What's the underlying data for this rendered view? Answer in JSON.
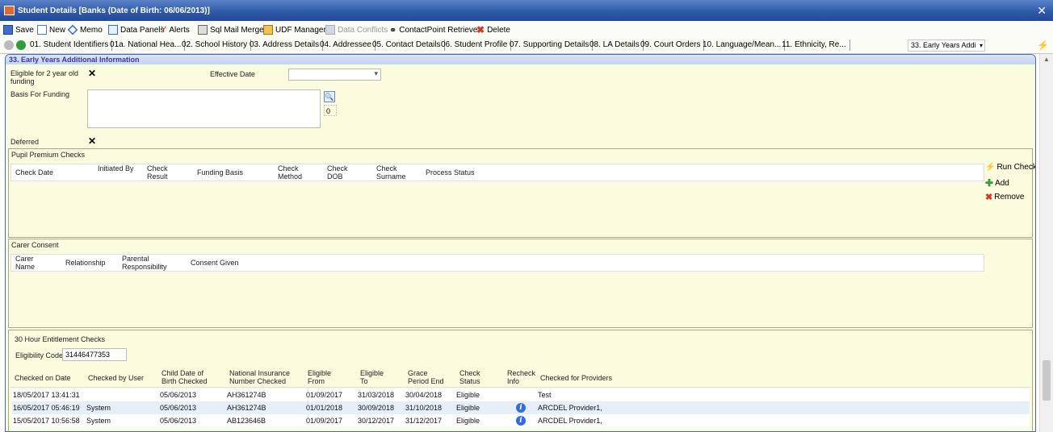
{
  "window": {
    "title": "Student Details [Banks      (Date of Birth: 06/06/2013)]"
  },
  "toolbar": {
    "save": "Save",
    "new": "New",
    "memo": "Memo",
    "data_panels": "Data Panels",
    "alerts": "Alerts",
    "sql_mail_merge": "Sql Mail Merge",
    "udf_manager": "UDF Manager",
    "data_conflicts": "Data Conflicts",
    "contactpoint_retrieve": "ContactPoint Retrieve",
    "delete": "Delete"
  },
  "tabs": [
    "01. Student Identifiers",
    "01a. National Hea...",
    "02. School History",
    "03. Address Details",
    "04. Addressee",
    "05. Contact Details",
    "06. Student Profile",
    "07. Supporting Details",
    "08. LA Details",
    "09. Court Orders",
    "10. Language/Mean...",
    "11. Ethnicity, Re..."
  ],
  "tab_select": {
    "value": "33. Early Years Addi"
  },
  "panel": {
    "title": "33. Early Years Additional Information",
    "eligible_label": "Eligible for 2 year old funding",
    "eligible_value": "✕",
    "effective_date_label": "Effective Date",
    "basis_label": "Basis For Funding",
    "basis_count": "0",
    "deferred_label": "Deferred",
    "deferred_value": "✕"
  },
  "pupil_premium": {
    "title": "Pupil Premium Checks",
    "columns": [
      "Check Date",
      "Initiated By",
      "Check Result",
      "Funding Basis",
      "Check Method",
      "Check DOB",
      "Check Surname",
      "Process Status"
    ],
    "actions": {
      "run_check": "Run Check",
      "add": "Add",
      "remove": "Remove"
    }
  },
  "carer_consent": {
    "title": "Carer Consent",
    "columns": [
      "Carer Name",
      "Relationship",
      "Parental Responsibility",
      "Consent Given"
    ]
  },
  "entitlement": {
    "title": "30 Hour Entitlement Checks",
    "eligibility_code_label": "Eligibility Code",
    "eligibility_code_value": "31446477353",
    "columns": [
      "Checked on Date",
      "Checked by User",
      "Child Date of Birth Checked",
      "National Insurance Number Checked",
      "Eligible From",
      "Eligible To",
      "Grace Period End",
      "Check Status",
      "Recheck Info",
      "Checked for Providers"
    ],
    "rows": [
      {
        "checked_on": "18/05/2017 13:41:31",
        "user": "",
        "dob": "05/06/2013",
        "ni": "AH361274B",
        "from": "01/09/2017",
        "to": "31/03/2018",
        "grace": "30/04/2018",
        "status": "Eligible",
        "info": false,
        "providers": "Test"
      },
      {
        "checked_on": "16/05/2017 05:46:19",
        "user": "System",
        "dob": "05/06/2013",
        "ni": "AH361274B",
        "from": "01/01/2018",
        "to": "30/09/2018",
        "grace": "31/10/2018",
        "status": "Eligible",
        "info": true,
        "providers": "ARCDEL Provider1,"
      },
      {
        "checked_on": "15/05/2017 10:56:58",
        "user": "System",
        "dob": "05/06/2013",
        "ni": "AB123646B",
        "from": "01/09/2017",
        "to": "30/12/2017",
        "grace": "31/12/2017",
        "status": "Eligible",
        "info": true,
        "providers": "ARCDEL Provider1,"
      }
    ]
  },
  "colors": {
    "title_bar": "#2f5ba8",
    "panel_bg": "#fbfbdd",
    "panel_head_text": "#3a36a8",
    "row_alt": "#e6eef8"
  },
  "icons": [
    "save-icon",
    "new-icon",
    "memo-icon",
    "data-panels-icon",
    "alerts-icon",
    "sql-mail-merge-icon",
    "udf-manager-icon",
    "data-conflicts-icon",
    "binoculars-icon",
    "delete-icon",
    "search-icon",
    "lightning-icon",
    "add-icon",
    "remove-icon",
    "info-icon"
  ]
}
